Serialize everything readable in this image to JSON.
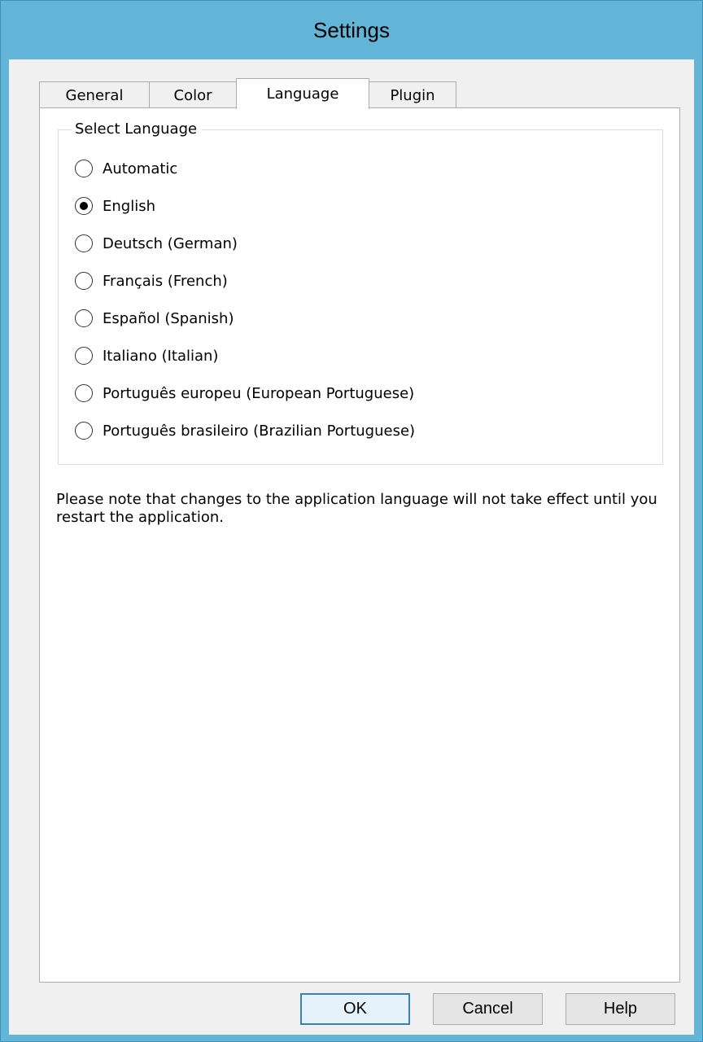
{
  "window": {
    "title": "Settings"
  },
  "tabs": [
    {
      "label": "General",
      "active": false
    },
    {
      "label": "Color",
      "active": false
    },
    {
      "label": "Language",
      "active": true
    },
    {
      "label": "Plugin",
      "active": false
    }
  ],
  "language_group": {
    "legend": "Select Language",
    "selected": "English",
    "options": [
      {
        "label": "Automatic",
        "selected": false
      },
      {
        "label": "English",
        "selected": true
      },
      {
        "label": "Deutsch (German)",
        "selected": false
      },
      {
        "label": "Français (French)",
        "selected": false
      },
      {
        "label": "Español (Spanish)",
        "selected": false
      },
      {
        "label": "Italiano (Italian)",
        "selected": false
      },
      {
        "label": "Português europeu (European Portuguese)",
        "selected": false
      },
      {
        "label": "Português brasileiro (Brazilian Portuguese)",
        "selected": false
      }
    ]
  },
  "note": "Please note that changes to the application language will not take effect until you restart the application.",
  "buttons": {
    "ok": "OK",
    "cancel": "Cancel",
    "help": "Help"
  },
  "colors": {
    "titlebar": "#62b5d6",
    "dialog_background": "#f0f0f0",
    "default_button_border": "#3c7fb1"
  }
}
